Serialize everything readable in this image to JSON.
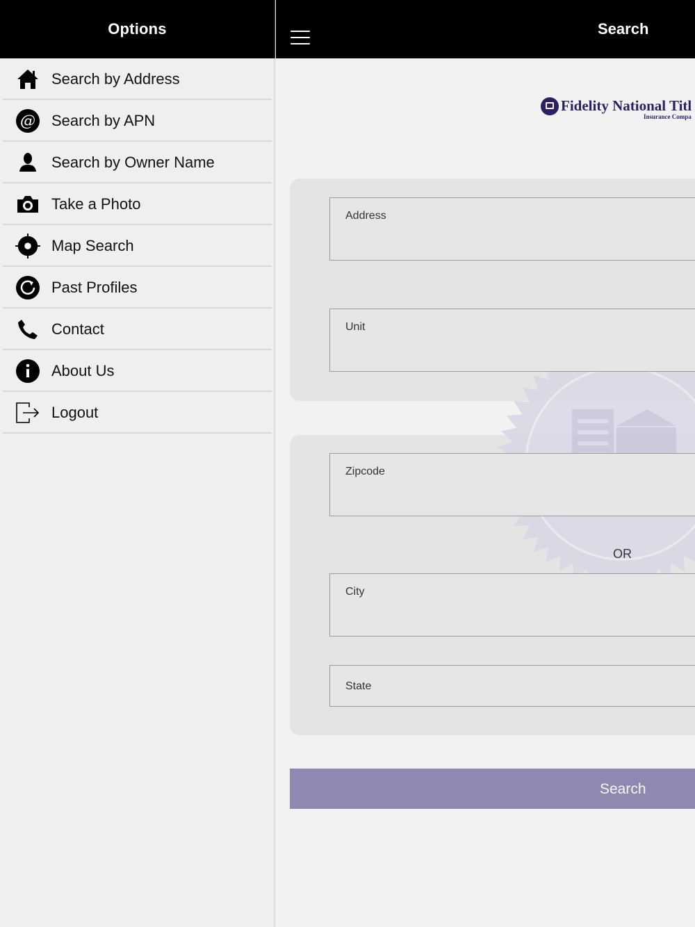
{
  "sidebar": {
    "title": "Options",
    "items": [
      {
        "label": "Search by Address",
        "icon": "home-icon"
      },
      {
        "label": "Search by APN",
        "icon": "at-sign-icon"
      },
      {
        "label": "Search by Owner Name",
        "icon": "person-icon"
      },
      {
        "label": "Take a Photo",
        "icon": "camera-icon"
      },
      {
        "label": "Map Search",
        "icon": "crosshair-icon"
      },
      {
        "label": "Past Profiles",
        "icon": "refresh-icon"
      },
      {
        "label": "Contact",
        "icon": "phone-icon"
      },
      {
        "label": "About Us",
        "icon": "info-icon"
      },
      {
        "label": "Logout",
        "icon": "logout-icon"
      }
    ]
  },
  "header": {
    "title": "Search",
    "menu_icon": "hamburger-icon"
  },
  "logo": {
    "name": "Fidelity National Titl",
    "subtitle": "Insurance Compa",
    "color": "#2c1f63"
  },
  "form": {
    "address_label": "Address",
    "unit_label": "Unit",
    "zipcode_label": "Zipcode",
    "or_text": "OR",
    "city_label": "City",
    "state_label": "State",
    "search_button": "Search"
  },
  "colors": {
    "header_bg": "#000000",
    "button_bg": "#8f89b1",
    "seal_color": "#d9d6e6"
  }
}
